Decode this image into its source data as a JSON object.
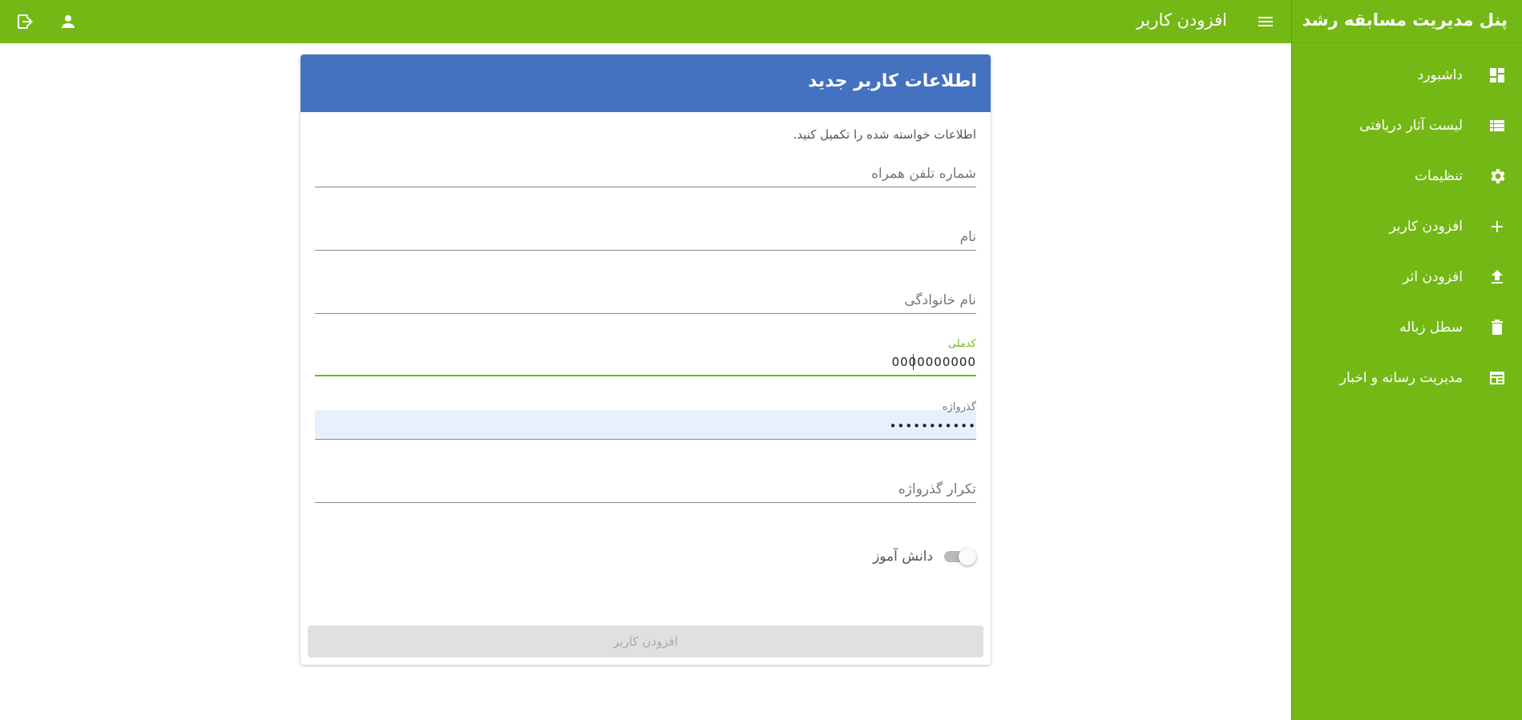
{
  "app": {
    "brand": "پنل مدیریت مسابقه رشد",
    "page_title": "افزودن کاربر"
  },
  "colors": {
    "primary_green": "#74b816",
    "header_blue": "#4472c0"
  },
  "topbar": {
    "icons": [
      "logout-icon",
      "user-icon",
      "menu-icon"
    ]
  },
  "sidebar": {
    "items": [
      {
        "label": "داشبورد",
        "icon": "dashboard-icon"
      },
      {
        "label": "لیست آثار دریافتی",
        "icon": "list-icon"
      },
      {
        "label": "تنظیمات",
        "icon": "gear-icon"
      },
      {
        "label": "افزودن کاربر",
        "icon": "plus-icon"
      },
      {
        "label": "افزودن اثر",
        "icon": "upload-icon"
      },
      {
        "label": "سطل زباله",
        "icon": "trash-icon"
      },
      {
        "label": "مدیریت رسانه و اخبار",
        "icon": "news-icon"
      }
    ]
  },
  "form": {
    "title": "اطلاعات کاربر جدید",
    "intro": "اطلاعات خواسته شده را تکمیل کنید.",
    "phone": {
      "placeholder": "شماره تلفن همراه",
      "value": ""
    },
    "first_name": {
      "placeholder": "نام",
      "value": ""
    },
    "last_name": {
      "placeholder": "نام خانوادگی",
      "value": ""
    },
    "national_code": {
      "label": "کدملی",
      "value": "0000000000"
    },
    "password": {
      "label": "گذرواژه",
      "value": "•••••••••••"
    },
    "password_confirm": {
      "placeholder": "تکرار گذرواژه",
      "value": ""
    },
    "student_toggle": {
      "label": "دانش آموز",
      "checked": false
    },
    "submit_label": "افزودن کاربر"
  }
}
